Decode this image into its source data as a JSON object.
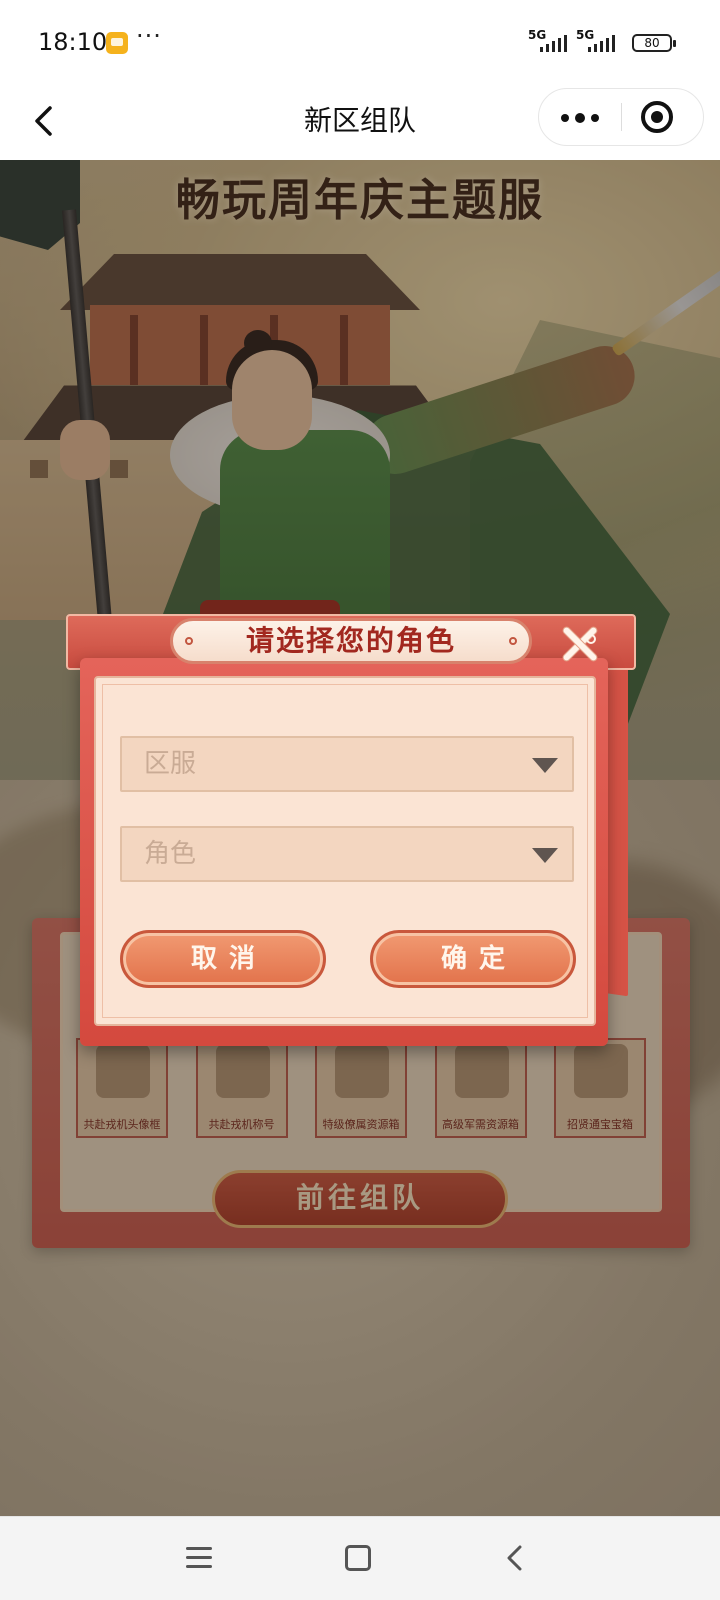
{
  "status_bar": {
    "time": "18:10",
    "more": "···",
    "signal1": "5G",
    "signal2": "5G",
    "battery": "80"
  },
  "nav": {
    "title": "新区组队"
  },
  "game": {
    "banner_title": "畅玩周年庆主题服",
    "rewards": [
      {
        "label": "共赴戎机头像框",
        "icon": "avatar-frame-icon"
      },
      {
        "label": "共赴戎机称号",
        "icon": "title-plaque-icon"
      },
      {
        "label": "特级僚属资源箱",
        "icon": "chest-icon"
      },
      {
        "label": "高级军需资源箱",
        "icon": "chest-icon"
      },
      {
        "label": "招贤通宝宝箱",
        "icon": "treasure-box-icon"
      }
    ],
    "go_team_label": "前往组队"
  },
  "modal": {
    "title": "请选择您的角色",
    "server_select": {
      "placeholder": "区服"
    },
    "role_select": {
      "placeholder": "角色"
    },
    "cancel_label": "取消",
    "confirm_label": "确定"
  },
  "colors": {
    "modal_red": "#d4493e",
    "card_bg": "#fbe4d4",
    "button_orange": "#e2724b",
    "title_red": "#a2281f"
  }
}
